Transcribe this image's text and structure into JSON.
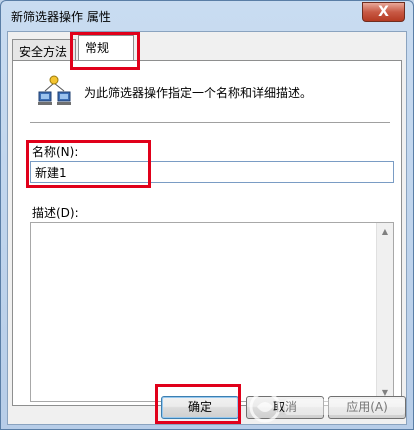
{
  "window": {
    "title": "新筛选器操作 属性",
    "close_glyph": "X"
  },
  "tabs": [
    {
      "label": "安全方法"
    },
    {
      "label": "常规"
    }
  ],
  "general": {
    "description": "为此筛选器操作指定一个名称和详细描述。",
    "name_label": "名称(N):",
    "name_value": "新建1",
    "desc_label": "描述(D):",
    "desc_value": ""
  },
  "buttons": {
    "ok": "确定",
    "cancel": "取消",
    "apply": "应用(A)"
  },
  "icons": {
    "close": "close-icon",
    "network": "network-computers-icon",
    "scroll_up": "scroll-up-icon",
    "scroll_down": "scroll-down-icon"
  },
  "colors": {
    "highlight": "#e0001a",
    "title_bg": "#c9dcf1",
    "close_bg": "#c85a45"
  }
}
